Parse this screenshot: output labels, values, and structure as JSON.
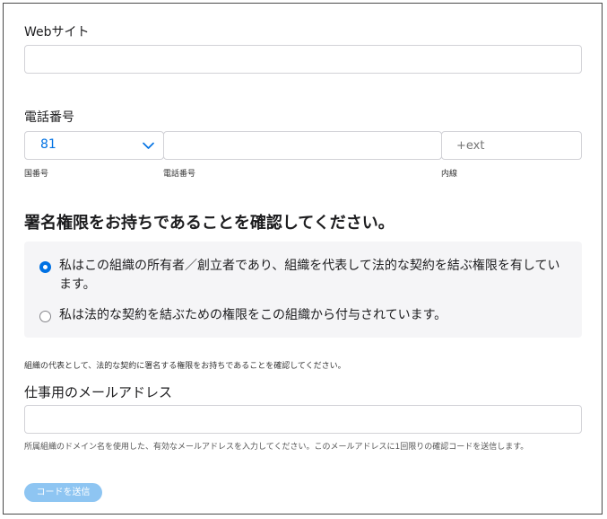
{
  "website": {
    "label": "Webサイト",
    "value": ""
  },
  "phone": {
    "label": "電話番号",
    "country_code": "81",
    "number_value": "",
    "ext_placeholder": "+ext",
    "sub_labels": {
      "country": "国番号",
      "number": "電話番号",
      "ext": "内線"
    }
  },
  "signing_authority": {
    "heading": "署名権限をお持ちであることを確認してください。",
    "options": [
      {
        "label": "私はこの組織の所有者／創立者であり、組織を代表して法的な契約を結ぶ権限を有しています。",
        "selected": true
      },
      {
        "label": "私は法的な契約を結ぶための権限をこの組織から付与されています。",
        "selected": false
      }
    ],
    "note": "組織の代表として、法的な契約に署名する権限をお持ちであることを確認してください。"
  },
  "work_email": {
    "label": "仕事用のメールアドレス",
    "value": "",
    "help": "所属組織のドメイン名を使用した、有効なメールアドレスを入力してください。このメールアドレスに1回限りの確認コードを送信します。"
  },
  "send_code_button": "コードを送信",
  "colors": {
    "accent": "#0071e3",
    "button_disabled": "#8ec5f2",
    "panel_bg": "#f5f5f7",
    "border": "#d2d2d7"
  }
}
